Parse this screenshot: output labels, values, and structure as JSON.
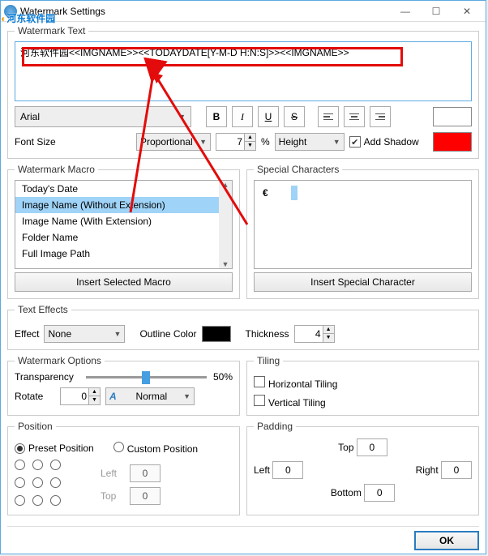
{
  "window": {
    "title": "Watermark Settings"
  },
  "overlay_brand": "河东软件园",
  "watermark_text": {
    "legend": "Watermark Text",
    "value": "河东软件园<<IMGNAME>><<TODAYDATE[Y-M-D H:N:S]>><<IMGNAME>>"
  },
  "font": {
    "family": "Arial",
    "size_label": "Font Size",
    "size_mode": "Proportional",
    "size_value": "7",
    "unit": "%",
    "relative_to": "Height",
    "shadow_label": "Add Shadow",
    "shadow_checked": true,
    "text_color": "#ffffff",
    "shadow_color": "#ff0000"
  },
  "macros": {
    "legend": "Watermark Macro",
    "items": [
      "Today's Date",
      "Image Name (Without Extension)",
      "Image Name (With Extension)",
      "Folder Name",
      "Full Image Path"
    ],
    "selected_index": 1,
    "insert_btn": "Insert Selected Macro"
  },
  "special": {
    "legend": "Special Characters",
    "char": "€",
    "insert_btn": "Insert Special Character"
  },
  "effects": {
    "legend": "Text Effects",
    "effect_label": "Effect",
    "effect_value": "None",
    "outline_label": "Outline Color",
    "outline_color": "#000000",
    "thickness_label": "Thickness",
    "thickness_value": "4"
  },
  "options": {
    "legend": "Watermark Options",
    "transparency_label": "Transparency",
    "transparency_value": "50%",
    "rotate_label": "Rotate",
    "rotate_value": "0",
    "flip_value": "Normal"
  },
  "tiling": {
    "legend": "Tiling",
    "h_label": "Horizontal Tiling",
    "v_label": "Vertical Tiling"
  },
  "position": {
    "legend": "Position",
    "preset_label": "Preset Position",
    "custom_label": "Custom Position",
    "left_label": "Left",
    "top_label": "Top",
    "left_value": "0",
    "top_value": "0"
  },
  "padding": {
    "legend": "Padding",
    "top_label": "Top",
    "top_value": "0",
    "left_label": "Left",
    "left_value": "0",
    "right_label": "Right",
    "right_value": "0",
    "bottom_label": "Bottom",
    "bottom_value": "0"
  },
  "footer": {
    "ok": "OK"
  }
}
